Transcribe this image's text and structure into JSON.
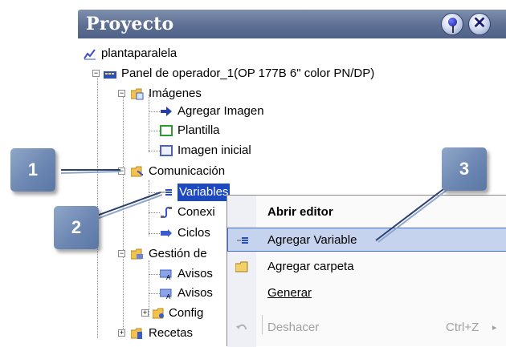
{
  "panel": {
    "title": "Proyecto",
    "pin_icon": "pin-icon",
    "close_icon": "close-icon"
  },
  "tree": {
    "project": "plantaparalela",
    "device": "Panel de operador_1(OP 177B 6\" color PN/DP)",
    "images_folder": "Imágenes",
    "add_image": "Agregar Imagen",
    "template": "Plantilla",
    "start_image": "Imagen inicial",
    "communication_folder": "Comunicación",
    "variables": "Variables",
    "connections": "Conexi",
    "cycles": "Ciclos",
    "alarms_folder": "Gestión de",
    "alarms_1": "Avisos",
    "alarms_2": "Avisos",
    "config": "Config",
    "recipes": "Recetas"
  },
  "context_menu": {
    "items": [
      {
        "label": "Abrir editor"
      },
      {
        "label": "Agregar Variable"
      },
      {
        "label": "Agregar carpeta"
      },
      {
        "label": "Generar"
      },
      {
        "label": "Deshacer",
        "shortcut": "Ctrl+Z",
        "disabled": true
      }
    ]
  },
  "callouts": [
    "1",
    "2",
    "3"
  ],
  "colors": {
    "titlebar": "#5d6f93",
    "selection": "#1c49c2",
    "menu_highlight": "#c6d3ef",
    "callout": "#6c87b2"
  }
}
